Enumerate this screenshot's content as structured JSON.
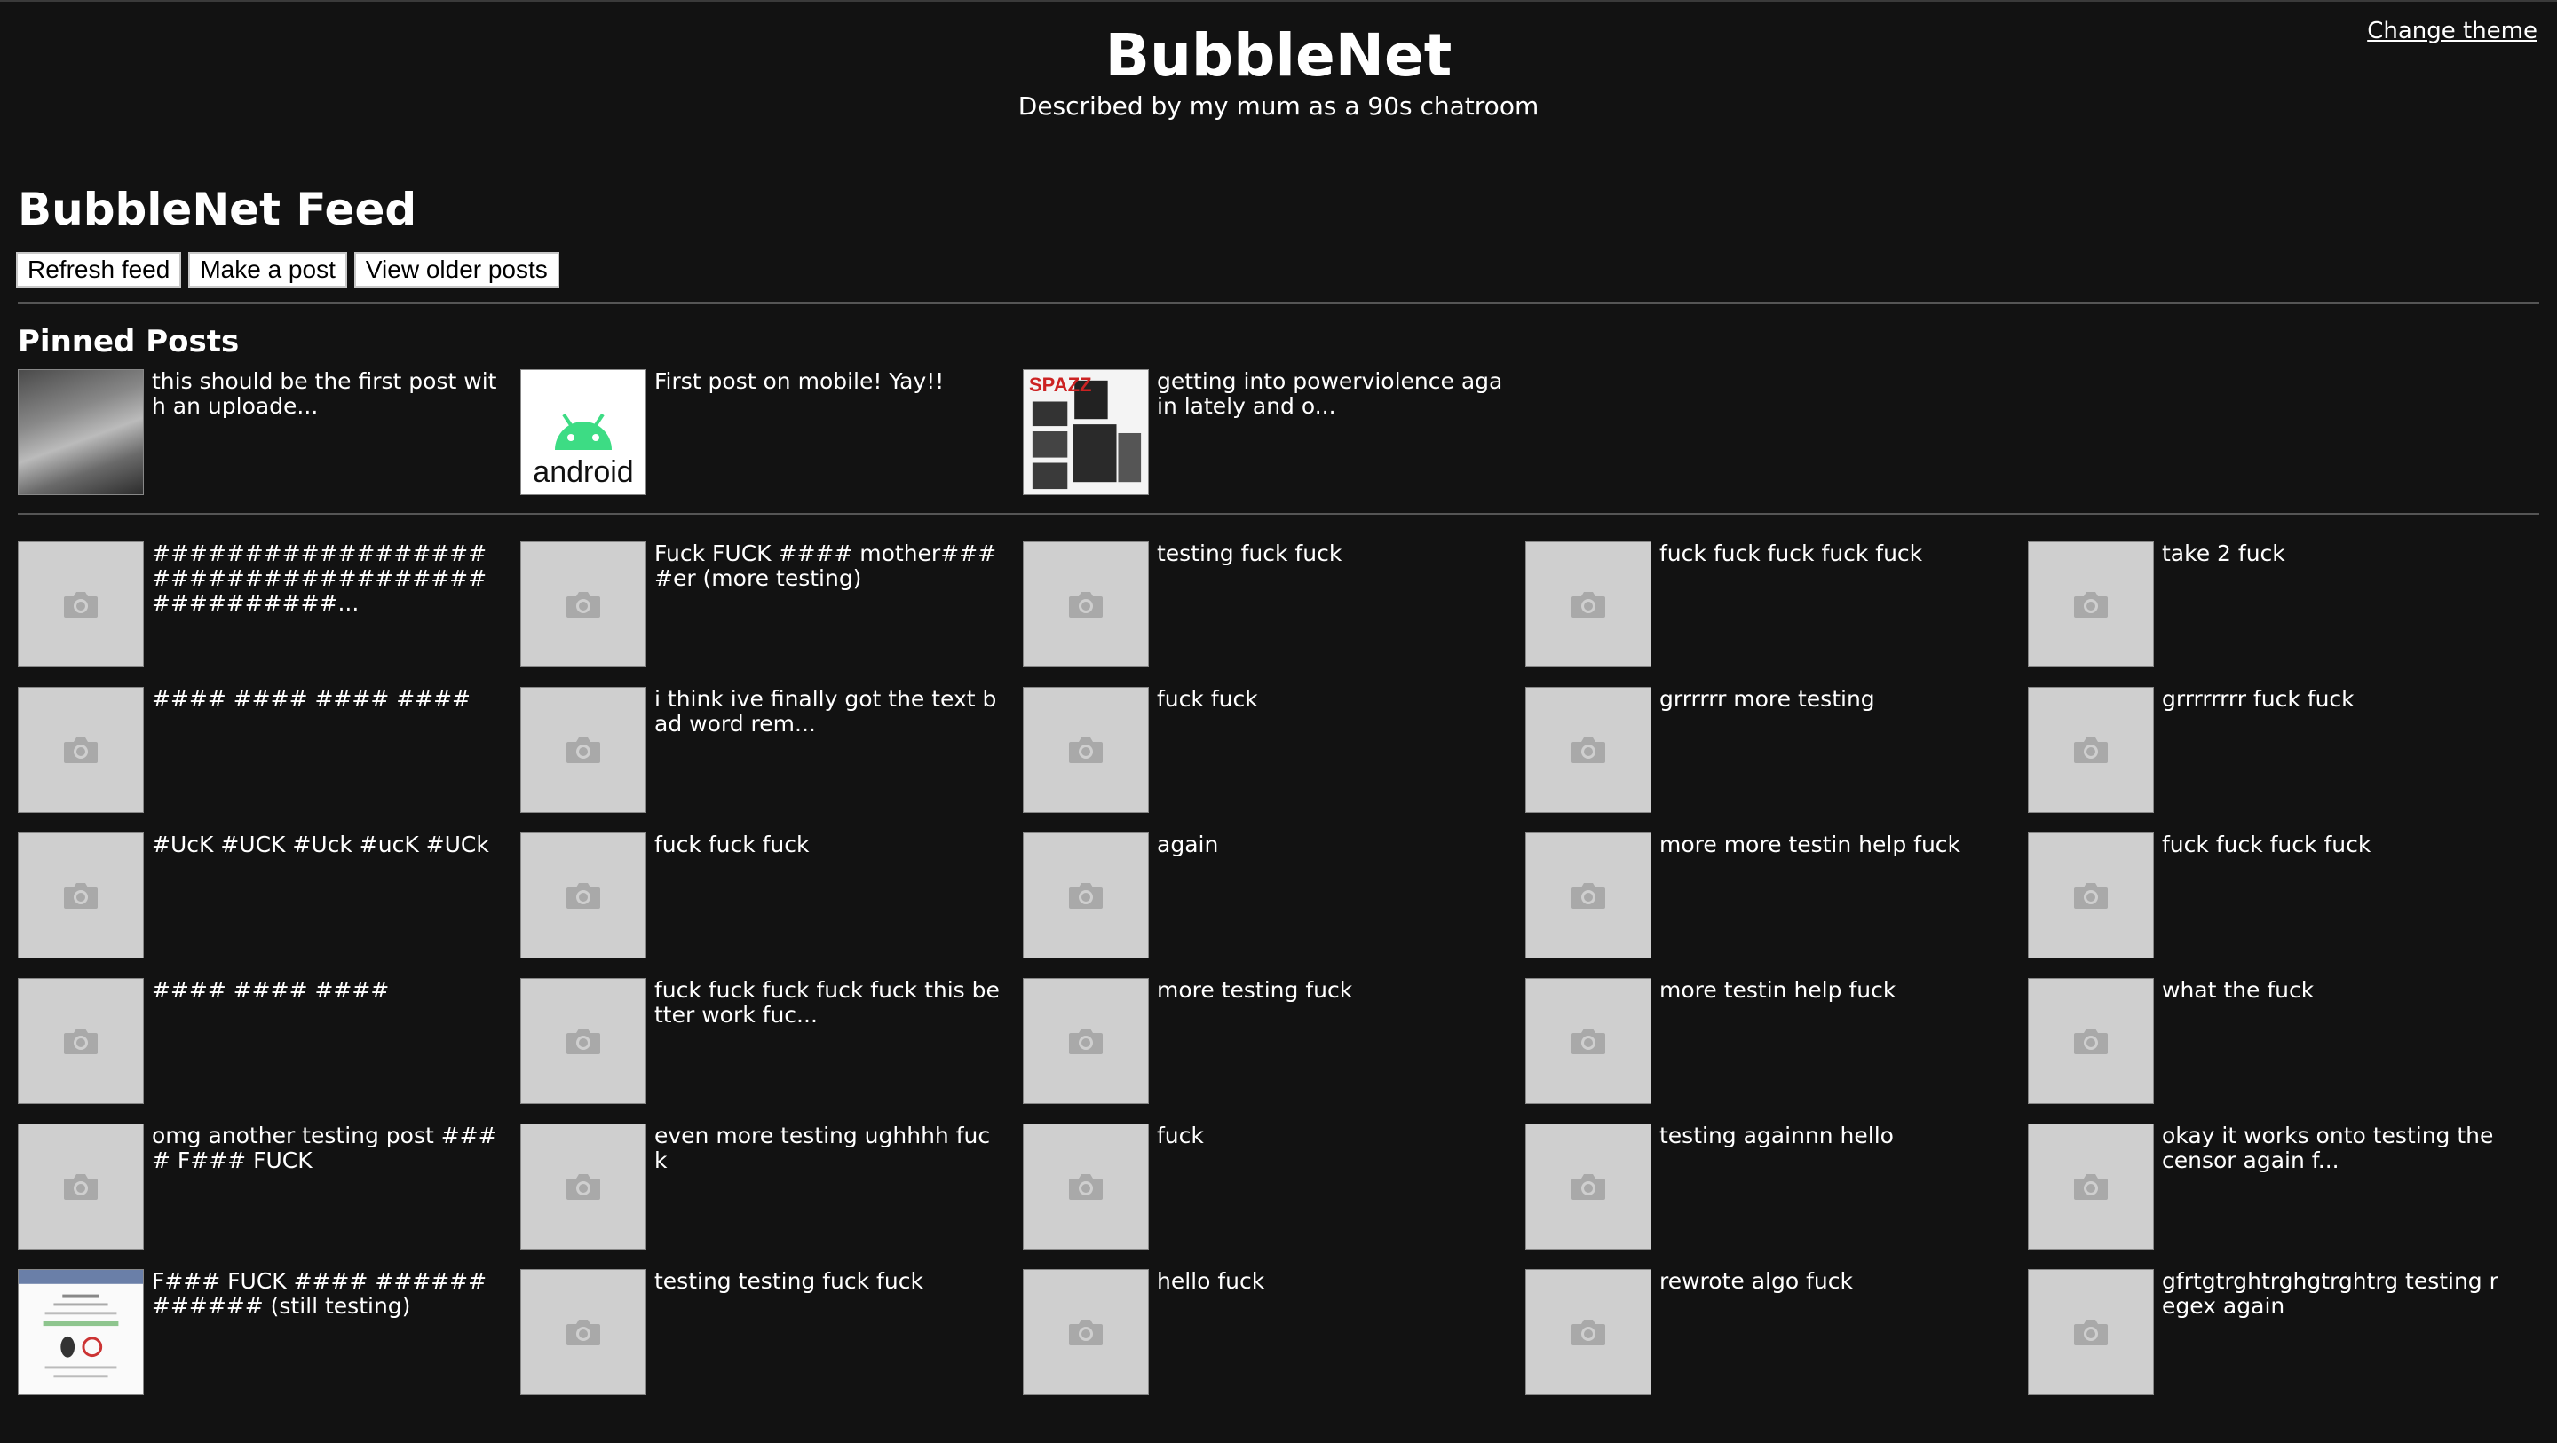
{
  "header": {
    "title": "BubbleNet",
    "subtitle": "Described by my mum as a 90s chatroom",
    "change_theme": "Change theme"
  },
  "feed": {
    "title": "BubbleNet Feed",
    "buttons": {
      "refresh": "Refresh feed",
      "make_post": "Make a post",
      "older": "View older posts"
    }
  },
  "pinned": {
    "title": "Pinned Posts",
    "items": [
      {
        "text": "this should be the first post with an uploade...",
        "thumb": "photo"
      },
      {
        "text": "First post on mobile! Yay!!",
        "thumb": "android",
        "thumb_label": "android"
      },
      {
        "text": "getting into powerviolence again lately and o...",
        "thumb": "album",
        "thumb_label": "SPAZZ"
      }
    ]
  },
  "posts": [
    {
      "text": "##############################################...",
      "thumb": "placeholder"
    },
    {
      "text": "Fuck FUCK #### mother####er (more testing)",
      "thumb": "placeholder"
    },
    {
      "text": "testing fuck fuck",
      "thumb": "placeholder"
    },
    {
      "text": "fuck fuck fuck fuck fuck",
      "thumb": "placeholder"
    },
    {
      "text": "take 2 fuck",
      "thumb": "placeholder"
    },
    {
      "text": "#### #### #### ####",
      "thumb": "placeholder"
    },
    {
      "text": "i think ive finally got the text bad word rem...",
      "thumb": "placeholder"
    },
    {
      "text": "fuck fuck",
      "thumb": "placeholder"
    },
    {
      "text": "grrrrrr more testing",
      "thumb": "placeholder"
    },
    {
      "text": "grrrrrrrr fuck fuck",
      "thumb": "placeholder"
    },
    {
      "text": "#UcK #UCK #Uck #ucK #UCk",
      "thumb": "placeholder"
    },
    {
      "text": "fuck fuck fuck",
      "thumb": "placeholder"
    },
    {
      "text": "again",
      "thumb": "placeholder"
    },
    {
      "text": "more more testin help fuck",
      "thumb": "placeholder"
    },
    {
      "text": "fuck fuck fuck fuck",
      "thumb": "placeholder"
    },
    {
      "text": "#### #### ####",
      "thumb": "placeholder"
    },
    {
      "text": "fuck fuck fuck fuck fuck this better work fuc...",
      "thumb": "placeholder"
    },
    {
      "text": "more testing fuck",
      "thumb": "placeholder"
    },
    {
      "text": "more testin help fuck",
      "thumb": "placeholder"
    },
    {
      "text": "what the fuck",
      "thumb": "placeholder"
    },
    {
      "text": "omg another testing post #### F### FUCK",
      "thumb": "placeholder"
    },
    {
      "text": "even more testing ughhhh fuck",
      "thumb": "placeholder"
    },
    {
      "text": "fuck",
      "thumb": "placeholder"
    },
    {
      "text": "testing againnn hello",
      "thumb": "placeholder"
    },
    {
      "text": "okay it works onto testing the censor again f...",
      "thumb": "placeholder"
    },
    {
      "text": "F### FUCK #### ############ (still testing)",
      "thumb": "document"
    },
    {
      "text": "testing testing fuck fuck",
      "thumb": "placeholder"
    },
    {
      "text": "hello fuck",
      "thumb": "placeholder"
    },
    {
      "text": "rewrote algo fuck",
      "thumb": "placeholder"
    },
    {
      "text": "gfrtgtrghtrghgtrghtrg testing regex again",
      "thumb": "placeholder"
    }
  ]
}
